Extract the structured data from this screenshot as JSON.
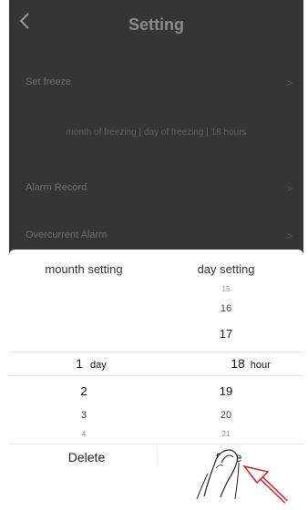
{
  "header": {
    "title": "Setting"
  },
  "rows": {
    "set_freeze": "Set freeze",
    "freeze_summary": "month of freezing | day of freezing | 18 hours",
    "alarm_record": "Alarm Record",
    "overcurrent_alarm": "Overcurrent Alarm"
  },
  "picker": {
    "left_header": "mounth setting",
    "right_header": "day setting",
    "left_selected_value": "1",
    "left_selected_unit": "day",
    "left_items": [
      "2",
      "3",
      "4"
    ],
    "right_items_above": [
      "15",
      "16",
      "17"
    ],
    "right_selected_value": "18",
    "right_selected_unit": "hour",
    "right_items_below": [
      "19",
      "20",
      "21"
    ]
  },
  "buttons": {
    "delete": "Delete",
    "save": "Safe"
  },
  "icons": [
    "chevron-left-icon",
    "chevron-right-icon",
    "hand-pointer-icon",
    "arrow-icon"
  ]
}
